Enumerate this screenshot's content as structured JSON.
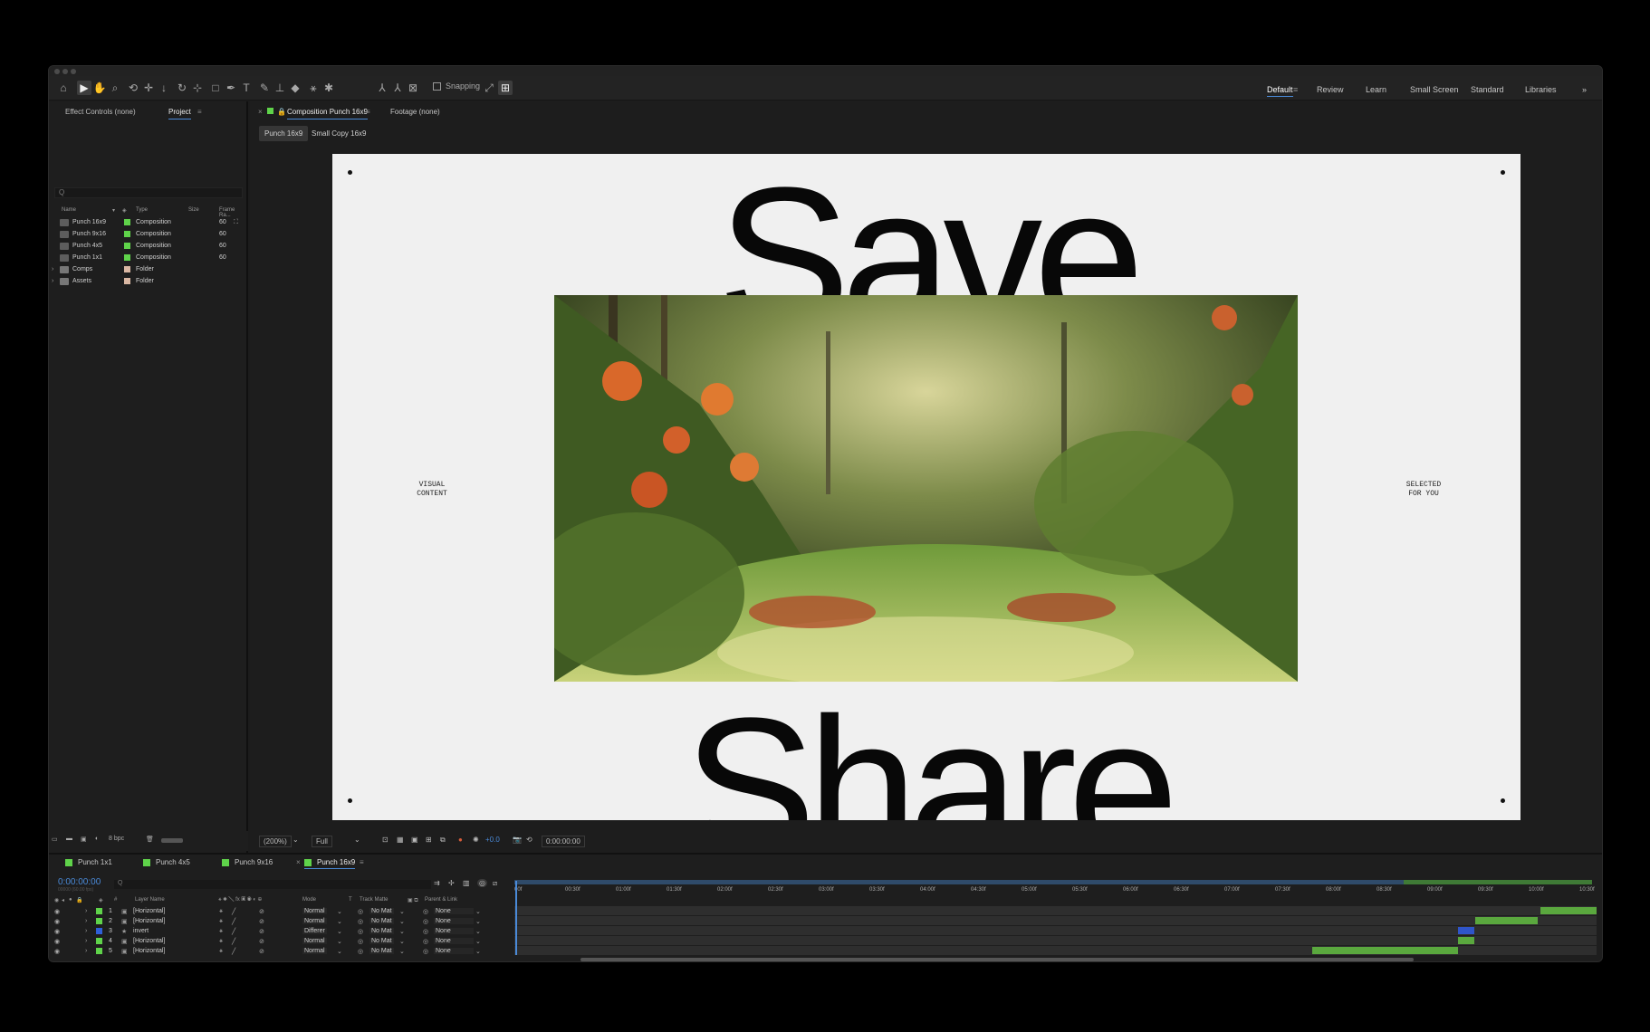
{
  "toolbar": {
    "snapping_label": "Snapping",
    "tools": [
      "home-icon",
      "selection-icon",
      "hand-icon",
      "zoom-icon",
      "orbit-icon",
      "pan-icon",
      "dolly-icon",
      "rotate-icon",
      "anchor-icon",
      "rectangle-icon",
      "pen-icon",
      "type-icon",
      "brush-icon",
      "clone-stamp-icon",
      "eraser-icon",
      "roto-brush-icon",
      "puppet-pin-icon"
    ]
  },
  "workspaces": [
    {
      "label": "Default",
      "active": true
    },
    {
      "label": "Review",
      "active": false
    },
    {
      "label": "Learn",
      "active": false
    },
    {
      "label": "Small Screen",
      "active": false
    },
    {
      "label": "Standard",
      "active": false
    },
    {
      "label": "Libraries",
      "active": false
    }
  ],
  "left_panel": {
    "tabs": [
      {
        "label": "Effect Controls (none)"
      },
      {
        "label": "Project"
      }
    ],
    "search_placeholder": "Q",
    "columns": {
      "name": "Name",
      "type": "Type",
      "size": "Size",
      "frame_rate": "Frame Ra..."
    },
    "items": [
      {
        "name": "Punch 16x9",
        "type": "Composition",
        "rate": "60",
        "color": "#5fd34a"
      },
      {
        "name": "Punch 9x16",
        "type": "Composition",
        "rate": "60",
        "color": "#5fd34a"
      },
      {
        "name": "Punch 4x5",
        "type": "Composition",
        "rate": "60",
        "color": "#5fd34a"
      },
      {
        "name": "Punch 1x1",
        "type": "Composition",
        "rate": "60",
        "color": "#5fd34a"
      },
      {
        "name": "Comps",
        "type": "Folder",
        "rate": "",
        "color": "#d9b7a3"
      },
      {
        "name": "Assets",
        "type": "Folder",
        "rate": "",
        "color": "#d9b7a3"
      }
    ],
    "bpc": "8 bpc"
  },
  "composition": {
    "tab_label": "Composition Punch 16x9",
    "footage_tab": "Footage (none)",
    "subtabs": [
      "Punch 16x9",
      "Small Copy 16x9"
    ],
    "heading_top": "Save",
    "heading_bottom": "Share",
    "left_caption_1": "VISUAL",
    "left_caption_2": "CONTENT",
    "right_caption_1": "SELECTED",
    "right_caption_2": "FOR YOU"
  },
  "viewer_bar": {
    "zoom": "(200%)",
    "resolution": "Full",
    "exposure": "+0.0",
    "timecode": "0:00:00:00"
  },
  "timeline": {
    "tabs": [
      {
        "label": "Punch 1x1",
        "color": "#5fd34a"
      },
      {
        "label": "Punch 4x5",
        "color": "#5fd34a"
      },
      {
        "label": "Punch 9x16",
        "color": "#5fd34a"
      },
      {
        "label": "Punch 16x9",
        "color": "#5fd34a"
      }
    ],
    "timecode": "0:00:00:00",
    "timecode_sub": "00000 (60.00 fps)",
    "columns": {
      "layer_name": "Layer Name",
      "mode": "Mode",
      "t": "T",
      "track_matte": "Track Matte",
      "parent": "Parent & Link"
    },
    "ruler": [
      "00f",
      "00:30f",
      "01:00f",
      "01:30f",
      "02:00f",
      "02:30f",
      "03:00f",
      "03:30f",
      "04:00f",
      "04:30f",
      "05:00f",
      "05:30f",
      "06:00f",
      "06:30f",
      "07:00f",
      "07:30f",
      "08:00f",
      "08:30f",
      "09:00f",
      "09:30f",
      "10:00f",
      "10:30f"
    ],
    "layers": [
      {
        "num": "1",
        "name": "[Horizontal]",
        "mode": "Normal",
        "matte": "No Mat",
        "parent": "None",
        "color": "#5fd34a",
        "bar_start": 0.948,
        "bar_end": 1.0,
        "bar_color": "#5aa83e"
      },
      {
        "num": "2",
        "name": "[Horizontal]",
        "mode": "Normal",
        "matte": "No Mat",
        "parent": "None",
        "color": "#5fd34a",
        "bar_start": 0.888,
        "bar_end": 0.946,
        "bar_color": "#5aa83e"
      },
      {
        "num": "3",
        "name": "invert",
        "mode": "Differer",
        "matte": "No Mat",
        "parent": "None",
        "color": "#2f5fd8",
        "bar_start": 0.872,
        "bar_end": 0.887,
        "bar_color": "#2f55c9"
      },
      {
        "num": "4",
        "name": "[Horizontal]",
        "mode": "Normal",
        "matte": "No Mat",
        "parent": "None",
        "color": "#5fd34a",
        "bar_start": 0.872,
        "bar_end": 0.887,
        "bar_color": "#5aa83e"
      },
      {
        "num": "5",
        "name": "[Horizontal]",
        "mode": "Normal",
        "matte": "No Mat",
        "parent": "None",
        "color": "#5fd34a",
        "bar_start": 0.737,
        "bar_end": 0.872,
        "bar_color": "#5aa83e"
      }
    ]
  },
  "colors": {
    "accent": "#4a8ad8",
    "label_green": "#5fd34a",
    "canvas_bg": "#f0f0f0"
  }
}
